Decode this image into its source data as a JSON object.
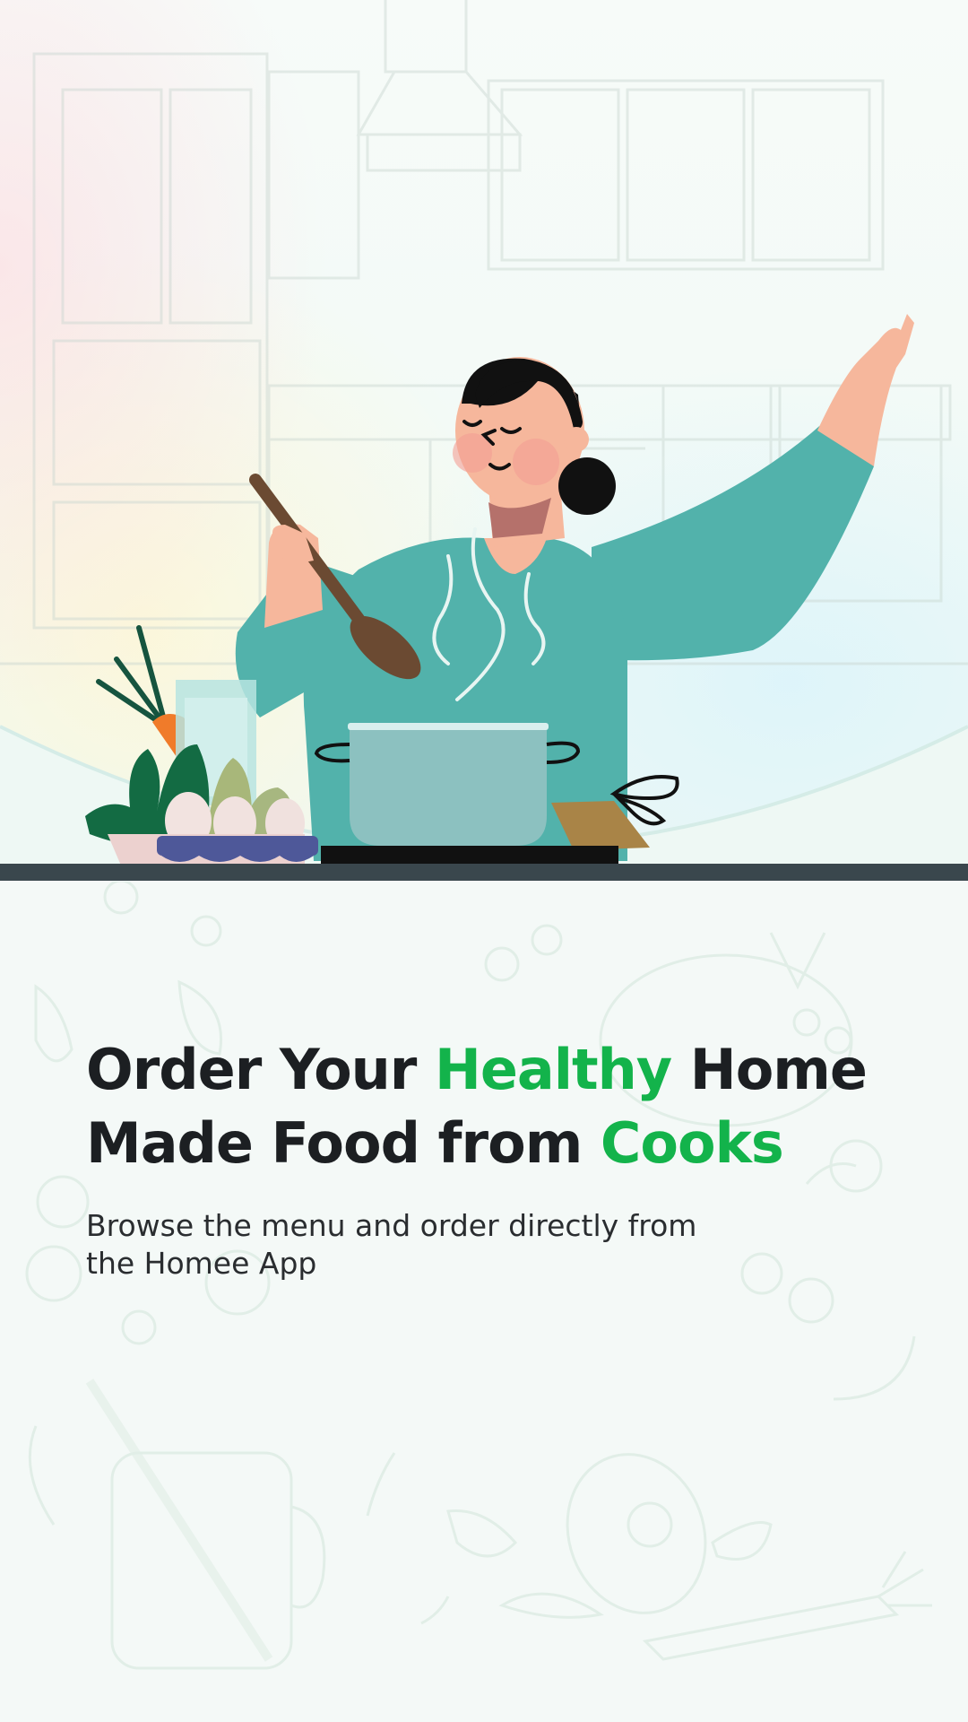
{
  "headline": {
    "part1": "Order Your ",
    "highlight1": "Healthy",
    "part2": " Home Made Food from ",
    "highlight2": "Cooks"
  },
  "subtitle": {
    "line1": "Browse the menu and order directly from",
    "line2": "the Homee App"
  },
  "icons": {
    "illustration": "woman-cooking-illustration",
    "background_top": "kitchen-sketch",
    "background_bottom": "food-doodles"
  },
  "colors": {
    "accent": "#13b34b",
    "headline_text": "#1c1f22",
    "body_text": "#2a2d30",
    "shirt": "#52b2ab",
    "counter": "#3a474d",
    "background": "#f4f9f7"
  }
}
